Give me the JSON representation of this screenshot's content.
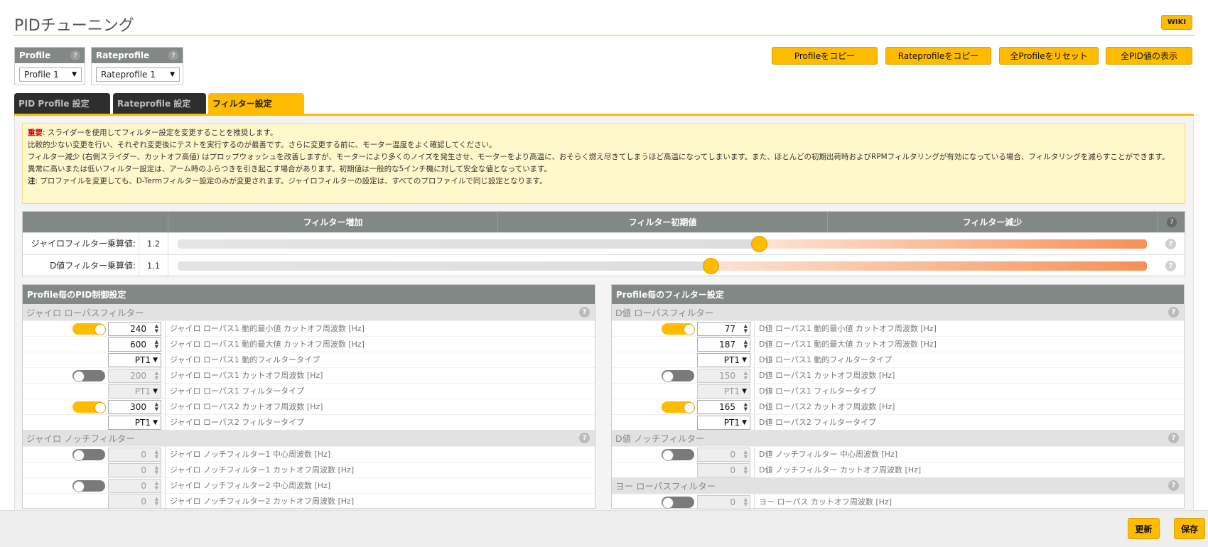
{
  "header": {
    "title": "PIDチューニング",
    "wiki_label": "WIKI"
  },
  "selectors": {
    "profile": {
      "label": "Profile",
      "value": "Profile 1"
    },
    "rateprofile": {
      "label": "Rateprofile",
      "value": "Rateprofile 1"
    },
    "help_glyph": "?"
  },
  "actions": {
    "copy_profile": "Profileをコピー",
    "copy_rateprofile": "Rateprofileをコピー",
    "reset_all": "全Profileをリセット",
    "show_all_pid": "全PID値の表示"
  },
  "tabs": [
    {
      "label": "PID Profile 設定",
      "active": false
    },
    {
      "label": "Rateprofile 設定",
      "active": false
    },
    {
      "label": "フィルター設定",
      "active": true
    }
  ],
  "notice": {
    "important_prefix": "重要",
    "line1": ": スライダーを使用してフィルター設定を変更することを推奨します。",
    "line2": "比較的少ない変更を行い、それぞれ変更後にテストを実行するのが最善です。さらに変更する前に、モーター温度をよく確認してください。",
    "line3": "フィルター減少 (右側スライダー、カットオフ高値) はプロップウォッシュを改善しますが、モーターにより多くのノイズを発生させ、モーターをより高温に、おそらく燃え尽きてしまうほど高温になってしまいます。また、ほとんどの初期出荷時およびRPMフィルタリングが有効になっている場合、フィルタリングを減らすことができます。",
    "line4": "異常に高いまたは低いフィルター設定は、アーム時のふらつきを引き起こす場合があります。初期値は一般的な5インチ機に対して安全な値となっています。",
    "note_prefix": "注",
    "line5": ": プロファイルを変更しても、D-Termフィルター設定のみが変更されます。ジャイロフィルターの設定は、すべてのプロファイルで同じ設定となります。"
  },
  "slider_table": {
    "headers": [
      "フィルター増加",
      "フィルター初期値",
      "フィルター減少"
    ],
    "rows": [
      {
        "label": "ジャイロフィルター乗算値:",
        "value": "1.2",
        "position": 0.6
      },
      {
        "label": "D値フィルター乗算値:",
        "value": "1.1",
        "position": 0.55
      }
    ]
  },
  "pid_panel": {
    "title": "Profile毎のPID制御設定",
    "sections": [
      {
        "title": "ジャイロ ローパスフィルター",
        "rows": [
          {
            "toggle": "on",
            "kind": "num",
            "value": "240",
            "label": "ジャイロ ローパス1 動的最小値 カットオフ周波数 [Hz]",
            "disabled": false
          },
          {
            "toggle": "none",
            "kind": "num",
            "value": "600",
            "label": "ジャイロ ローパス1 動的最大値 カットオフ周波数 [Hz]",
            "disabled": false
          },
          {
            "toggle": "none",
            "kind": "sel",
            "value": "PT1",
            "label": "ジャイロ ローパス1 動的フィルタータイプ",
            "disabled": false
          },
          {
            "toggle": "off",
            "kind": "num",
            "value": "200",
            "label": "ジャイロ ローパス1 カットオフ周波数 [Hz]",
            "disabled": true
          },
          {
            "toggle": "none",
            "kind": "sel",
            "value": "PT1",
            "label": "ジャイロ ローパス1 フィルタータイプ",
            "disabled": true
          },
          {
            "toggle": "on",
            "kind": "num",
            "value": "300",
            "label": "ジャイロ ローパス2 カットオフ周波数 [Hz]",
            "disabled": false
          },
          {
            "toggle": "none",
            "kind": "sel",
            "value": "PT1",
            "label": "ジャイロ ローパス2 フィルタータイプ",
            "disabled": false
          }
        ]
      },
      {
        "title": "ジャイロ ノッチフィルター",
        "rows": [
          {
            "toggle": "off",
            "kind": "num",
            "value": "0",
            "label": "ジャイロ ノッチフィルター1 中心周波数 [Hz]",
            "disabled": true
          },
          {
            "toggle": "none",
            "kind": "num",
            "value": "0",
            "label": "ジャイロ ノッチフィルター1 カットオフ周波数 [Hz]",
            "disabled": true
          },
          {
            "toggle": "off",
            "kind": "num",
            "value": "0",
            "label": "ジャイロ ノッチフィルター2 中心周波数 [Hz]",
            "disabled": true
          },
          {
            "toggle": "none",
            "kind": "num",
            "value": "0",
            "label": "ジャイロ ノッチフィルター2 カットオフ周波数 [Hz]",
            "disabled": true
          }
        ]
      }
    ]
  },
  "filter_panel": {
    "title": "Profile毎のフィルター設定",
    "sections": [
      {
        "title": "D値 ローパスフィルター",
        "rows": [
          {
            "toggle": "on",
            "kind": "num",
            "value": "77",
            "label": "D値 ローパス1 動的最小値 カットオフ周波数 [Hz]",
            "disabled": false
          },
          {
            "toggle": "none",
            "kind": "num",
            "value": "187",
            "label": "D値 ローパス1 動的最大値 カットオフ周波数 [Hz]",
            "disabled": false
          },
          {
            "toggle": "none",
            "kind": "sel",
            "value": "PT1",
            "label": "D値 ローパス1 動的フィルタータイプ",
            "disabled": false
          },
          {
            "toggle": "off",
            "kind": "num",
            "value": "150",
            "label": "D値 ローパス1 カットオフ周波数 [Hz]",
            "disabled": true
          },
          {
            "toggle": "none",
            "kind": "sel",
            "value": "PT1",
            "label": "D値 ローパス1 フィルタータイプ",
            "disabled": true
          },
          {
            "toggle": "on",
            "kind": "num",
            "value": "165",
            "label": "D値 ローパス2 カットオフ周波数 [Hz]",
            "disabled": false
          },
          {
            "toggle": "none",
            "kind": "sel",
            "value": "PT1",
            "label": "D値 ローパス2 フィルタータイプ",
            "disabled": false
          }
        ]
      },
      {
        "title": "D値 ノッチフィルター",
        "rows": [
          {
            "toggle": "off",
            "kind": "num",
            "value": "0",
            "label": "D値 ノッチフィルター 中心周波数 [Hz]",
            "disabled": true
          },
          {
            "toggle": "none",
            "kind": "num",
            "value": "0",
            "label": "D値 ノッチフィルター カットオフ周波数 [Hz]",
            "disabled": true
          }
        ]
      },
      {
        "title": "ヨー ローパスフィルター",
        "rows": [
          {
            "toggle": "off",
            "kind": "num",
            "value": "0",
            "label": "ヨー ローパス カットオフ周波数 [Hz]",
            "disabled": true
          }
        ]
      }
    ]
  },
  "footer": {
    "refresh_label": "更新",
    "save_label": "保存"
  },
  "colors": {
    "accent": "#ffbb00",
    "header_gray": "#828885",
    "tab_dark": "#2e2e2e",
    "slider_hot": "#f79056"
  }
}
